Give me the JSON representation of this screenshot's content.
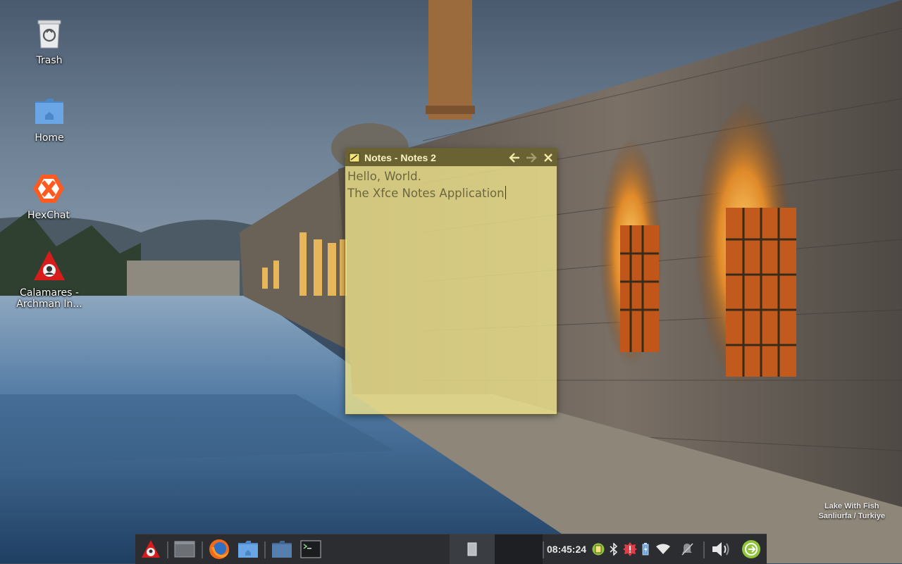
{
  "desktop": {
    "icons": [
      {
        "label": "Trash",
        "icon": "trash-icon"
      },
      {
        "label": "Home",
        "icon": "home-folder-icon"
      },
      {
        "label": "HexChat",
        "icon": "hexchat-icon"
      },
      {
        "label": "Calamares - Archman In...",
        "icon": "calamares-installer-icon"
      }
    ]
  },
  "notes": {
    "title": "Notes - Notes 2",
    "lines": [
      "Hello, World.",
      "The Xfce Notes Application"
    ],
    "colors": {
      "titlebar": "#6a6233",
      "body": "#f0e38c"
    }
  },
  "wallpaper": {
    "caption_line1": "Lake With Fish",
    "caption_line2": "Sanliurfa / Turkiye"
  },
  "panel": {
    "clock": "08:45:24",
    "launchers": [
      "archman-menu-icon",
      "show-desktop-icon",
      "firefox-icon",
      "home-folder-icon",
      "file-manager-icon",
      "terminal-icon"
    ],
    "tray": [
      "notes-tray-icon",
      "bluetooth-icon",
      "update-notifier-icon",
      "battery-icon",
      "wifi-icon",
      "notifications-muted-icon",
      "volume-icon",
      "session-logout-icon"
    ]
  }
}
